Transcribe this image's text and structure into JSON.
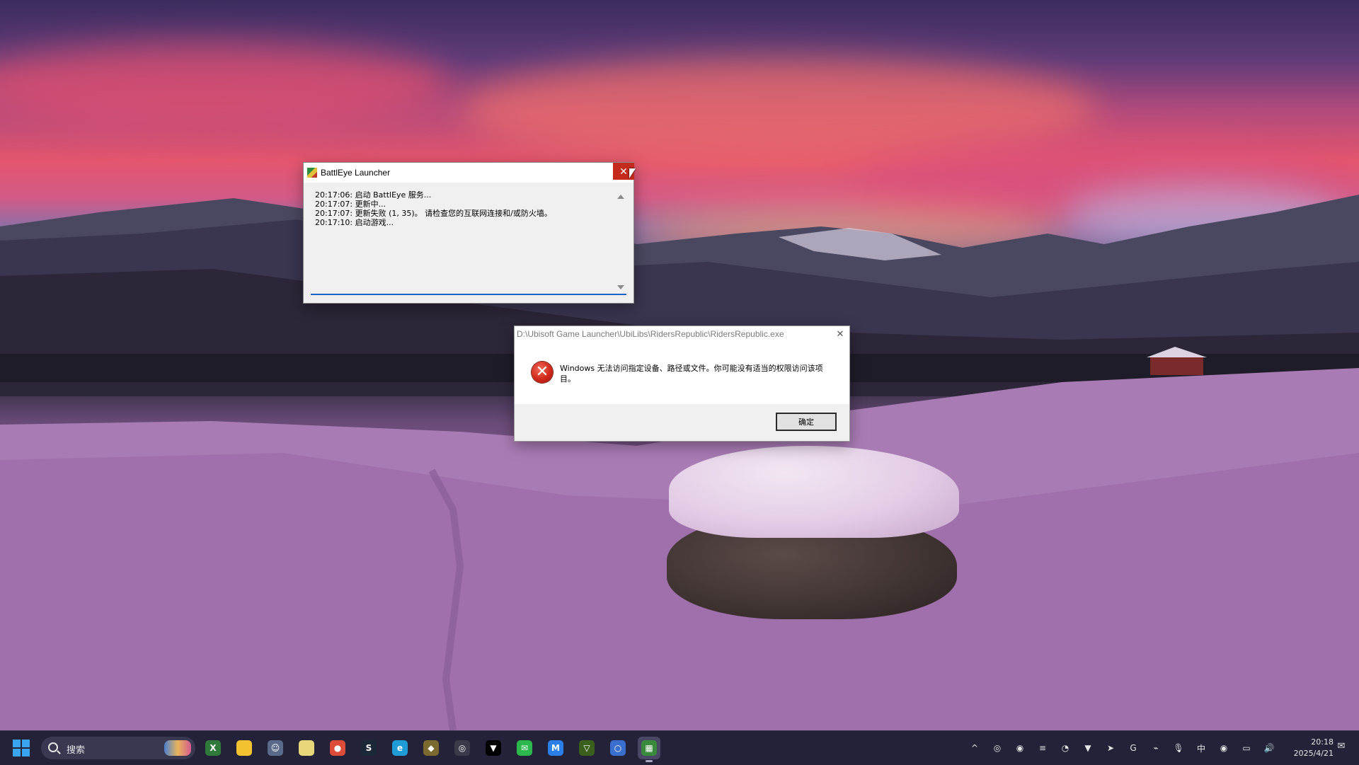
{
  "battleye": {
    "title": "BattlEye Launcher",
    "close_label": "✕",
    "log": [
      "20:17:06: 启动 BattlEye 服务...",
      "20:17:07: 更新中...",
      "20:17:07: 更新失败 (1, 35)。 请检查您的互联网连接和/或防火墙。",
      "20:17:10: 启动游戏..."
    ]
  },
  "error_dialog": {
    "title": "D:\\Ubisoft Game Launcher\\UbiLibs\\RidersRepublic\\RidersRepublic.exe",
    "close_label": "✕",
    "icon_glyph": "✕",
    "message": "Windows 无法访问指定设备、路径或文件。你可能没有适当的权限访问该项目。",
    "ok_label": "确定"
  },
  "taskbar": {
    "search_placeholder": "搜索",
    "apps": [
      {
        "icon": "xbox-icon",
        "glyph": "X",
        "color": "#2f7a3a"
      },
      {
        "icon": "file-explorer-icon",
        "glyph": "",
        "color": "#f2c231"
      },
      {
        "icon": "avatar-app-icon",
        "glyph": "☺",
        "color": "#5a6a8a"
      },
      {
        "icon": "notepad-app-icon",
        "glyph": "",
        "color": "#e8d77a"
      },
      {
        "icon": "chrome-icon",
        "glyph": "●",
        "color": "#dd4b39"
      },
      {
        "icon": "steam-icon",
        "glyph": "S",
        "color": "#1b2838"
      },
      {
        "icon": "edge-like-icon",
        "glyph": "e",
        "color": "#1f9bd6"
      },
      {
        "icon": "game-app-icon",
        "glyph": "◆",
        "color": "#7a6a30"
      },
      {
        "icon": "ubisoft-icon",
        "glyph": "◎",
        "color": "#3a3a4a"
      },
      {
        "icon": "vpn-icon",
        "glyph": "▼",
        "color": "#000000"
      },
      {
        "icon": "wechat-icon",
        "glyph": "✉",
        "color": "#2db84d"
      },
      {
        "icon": "maps-app-icon",
        "glyph": "M",
        "color": "#2a7fe8"
      },
      {
        "icon": "accelerator-icon",
        "glyph": "▽",
        "color": "#3b5f1c"
      },
      {
        "icon": "browser-globe-icon",
        "glyph": "○",
        "color": "#3a6fd0"
      },
      {
        "icon": "battleye-icon",
        "glyph": "▦",
        "color": "#3a8a3e"
      }
    ],
    "tray": [
      "^",
      "◎",
      "◉",
      "≡",
      "◔",
      "▼",
      "➤",
      "G",
      "⌁",
      "🎙",
      "中",
      "◉",
      "▭",
      "🔊"
    ],
    "time": "20:18",
    "date": "2025/4/21",
    "notification_glyph": "✉"
  },
  "colors": {
    "close_red": "#c42b1c",
    "focus_blue": "#1e64c8",
    "taskbar_bg": "#242238"
  }
}
